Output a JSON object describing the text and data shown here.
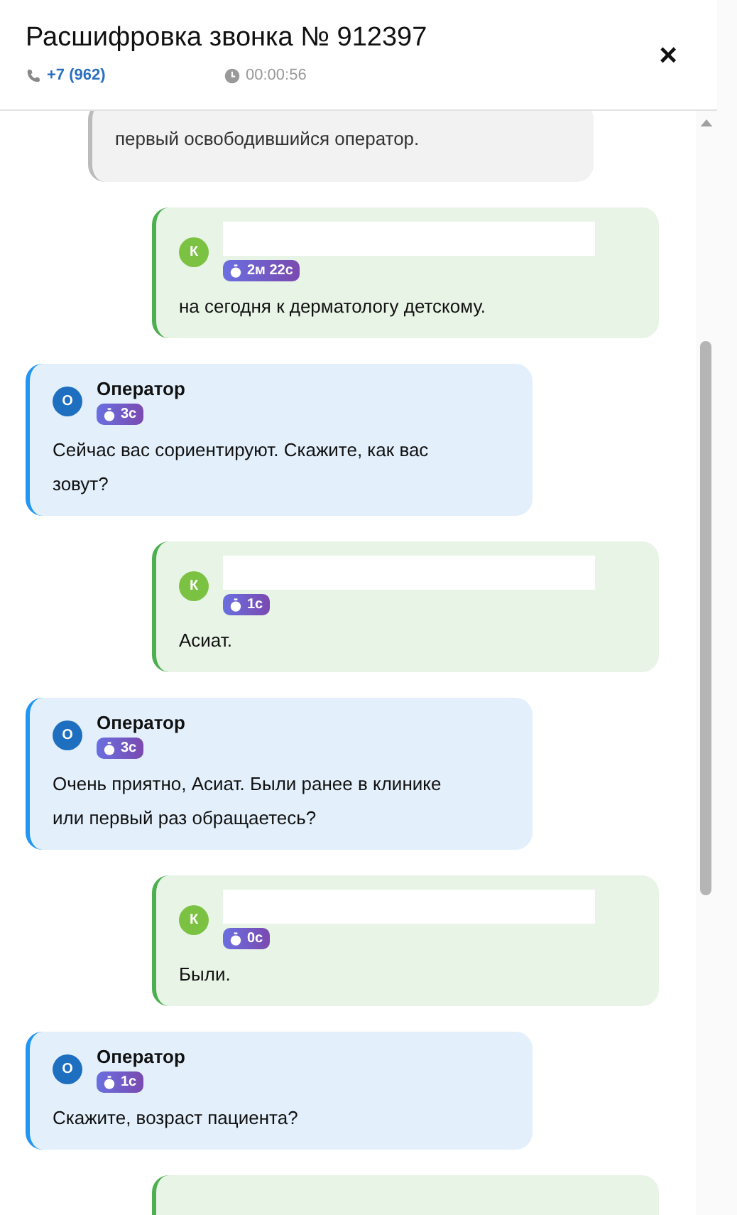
{
  "header": {
    "title": "Расшифровка звонка № 912397",
    "phone": "+7 (962)",
    "duration": "00:00:56",
    "close": "×"
  },
  "messages": [
    {
      "kind": "system",
      "text": "первый освободившийся оператор."
    },
    {
      "kind": "client",
      "avatar": "К",
      "time": "2м 22с",
      "text": "на сегодня к дерматологу детскому."
    },
    {
      "kind": "operator",
      "avatar": "О",
      "name": "Оператор",
      "time": "3с",
      "text": "Сейчас вас сориентируют. Скажите, как вас зовут?"
    },
    {
      "kind": "client",
      "avatar": "К",
      "time": "1с",
      "text": "Асиат."
    },
    {
      "kind": "operator",
      "avatar": "О",
      "name": "Оператор",
      "time": "3с",
      "text": "Очень приятно, Асиат. Были ранее в клинике или первый раз обращаетесь?"
    },
    {
      "kind": "client",
      "avatar": "К",
      "time": "0с",
      "text": "Были."
    },
    {
      "kind": "operator",
      "avatar": "О",
      "name": "Оператор",
      "time": "1с",
      "text": "Скажите, возраст пациента?"
    },
    {
      "kind": "client"
    }
  ]
}
